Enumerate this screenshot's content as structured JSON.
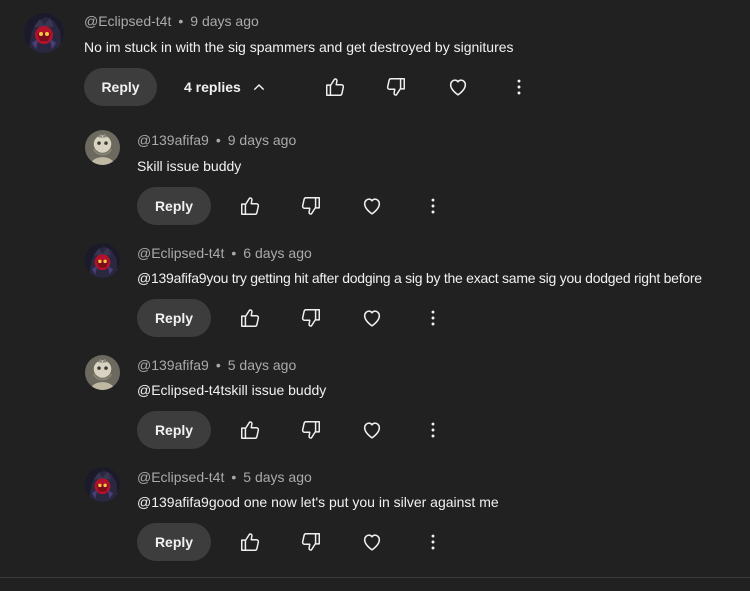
{
  "comment": {
    "author": "@Eclipsed-t4t",
    "time": "9 days ago",
    "separator": "•",
    "text": "No im stuck in with the sig spammers and get destroyed by signitures",
    "reply_label": "Reply",
    "replies_label": "4 replies"
  },
  "replies": [
    {
      "author": "@139afifa9",
      "time": "9 days ago",
      "separator": "•",
      "text": "Skill issue buddy",
      "reply_label": "Reply"
    },
    {
      "author": "@Eclipsed-t4t",
      "time": "6 days ago",
      "separator": "•",
      "text": "@139afifa9you try getting hit after dodging a sig by the exact same sig you dodged right before",
      "reply_label": "Reply"
    },
    {
      "author": "@139afifa9",
      "time": "5 days ago",
      "separator": "•",
      "text": "@Eclipsed-t4tskill issue buddy",
      "reply_label": "Reply"
    },
    {
      "author": "@Eclipsed-t4t",
      "time": "5 days ago",
      "separator": "•",
      "text": "@139afifa9good one now let's put you in silver against me",
      "reply_label": "Reply"
    }
  ],
  "icons": {
    "like": "thumbs-up-icon",
    "dislike": "thumbs-down-icon",
    "heart": "heart-icon",
    "more": "more-vertical-icon",
    "collapse": "chevron-up-icon"
  },
  "colors": {
    "background": "#212121",
    "text": "#f1f1f1",
    "meta": "#aaaaaa",
    "button": "#3d3d3d"
  }
}
